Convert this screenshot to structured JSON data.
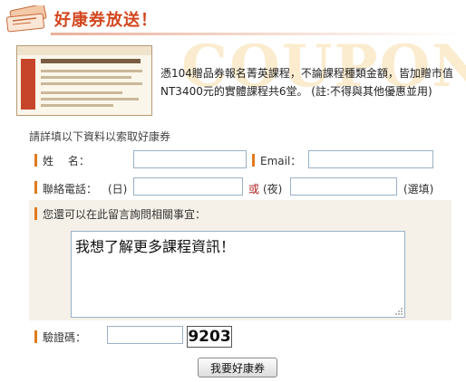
{
  "header": {
    "title": "好康券放送！"
  },
  "promo": {
    "bg_word": "COUPON",
    "text": "憑104贈品券報名菁英課程，不論課程種類金額，皆加贈市值\nNT3400元的實體課程共6堂。 (註:不得與其他優惠並用)"
  },
  "form": {
    "intro": "請詳填以下資料以索取好康券",
    "name_label": "姓　 名：",
    "name_value": "",
    "email_label": "Email：",
    "email_value": "",
    "phone_label": "聯絡電話：",
    "day_label": "(日)",
    "day_value": "",
    "or_label": "或",
    "night_label": "(夜)",
    "night_value": "",
    "optional_label": "(選填)",
    "message_label": "您還可以在此留言詢問相關事宜：",
    "message_value": "我想了解更多課程資訊！",
    "captcha_label": "驗證碼：",
    "captcha_value": "",
    "captcha_code": "9203",
    "submit_label": "我要好康券"
  },
  "colors": {
    "accent": "#e07a1f",
    "title": "#d2461e",
    "or": "#b02020"
  }
}
